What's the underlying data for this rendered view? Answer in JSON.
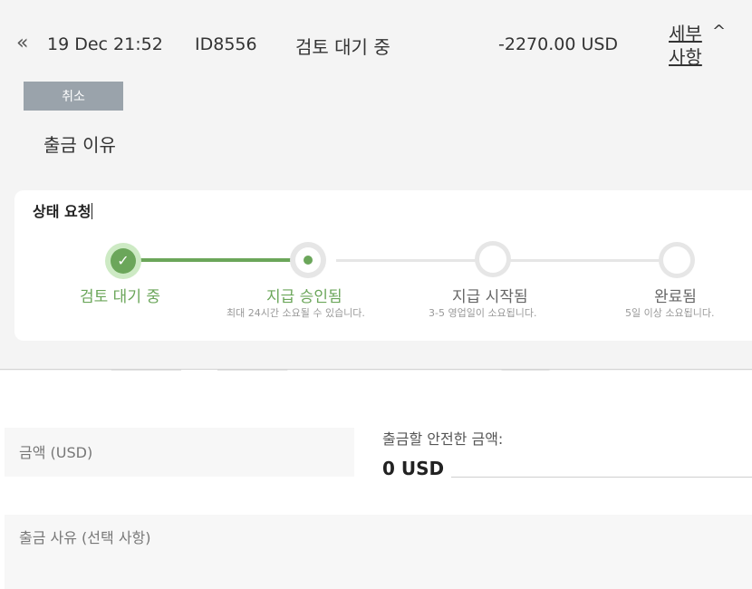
{
  "transaction": {
    "back_icon": "double-chevron-left-icon",
    "date": "19 Dec 21:52",
    "id": "ID8556",
    "status": "검토 대기 중",
    "amount": "-2270.00 USD",
    "details_label": "세부 사항",
    "details_toggle_icon": "chevron-up-icon"
  },
  "actions": {
    "cancel_label": "취소"
  },
  "withdraw_reason_title": "출금 이유",
  "status_card": {
    "title": "상태 요청",
    "steps": [
      {
        "label": "검토 대기 중",
        "note": "",
        "state": "done"
      },
      {
        "label": "지급 승인됨",
        "note": "최대 24시간 소요될 수 있습니다.",
        "state": "active"
      },
      {
        "label": "지급 시작됨",
        "note": "3-5 영업일이 소요됩니다.",
        "state": "pending"
      },
      {
        "label": "완료됨",
        "note": "5일 이상 소요됩니다.",
        "state": "pending"
      }
    ],
    "colors": {
      "active": "#6ba65a",
      "inactive": "#e6e6e6"
    }
  },
  "form": {
    "amount_placeholder": "금액 (USD)",
    "safe_amount_label": "출금할 안전한 금액:",
    "safe_amount_value": "0 USD",
    "reason_placeholder": "출금 사유 (선택 사항)"
  }
}
